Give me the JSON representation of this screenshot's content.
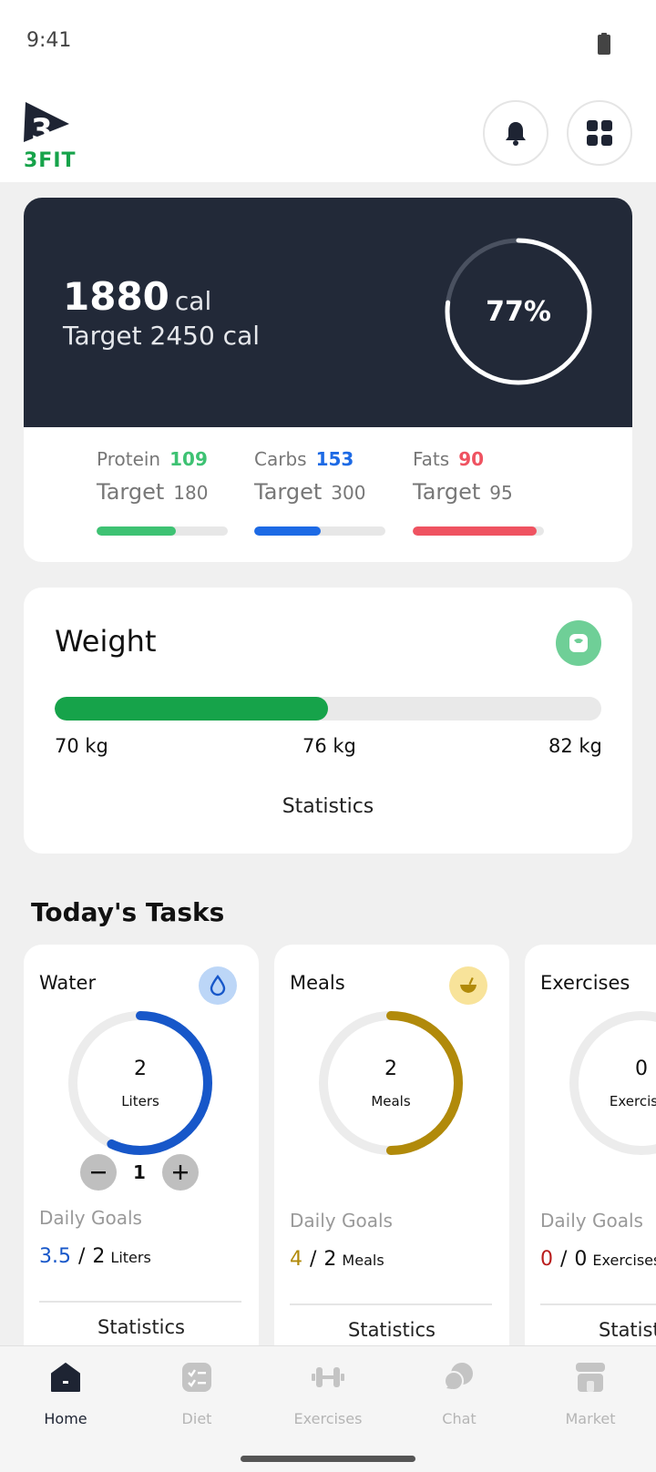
{
  "status": {
    "time": "9:41"
  },
  "app": {
    "logo_text": "3FIT"
  },
  "calories": {
    "current": "1880",
    "unit": "cal",
    "target_text": "Target 2450 cal",
    "percent_text": "77%",
    "percent_value": 77
  },
  "macros": [
    {
      "name": "Protein",
      "value": "109",
      "target_label": "Target",
      "target": "180",
      "color": "#3ec273",
      "fill": 0.605
    },
    {
      "name": "Carbs",
      "value": "153",
      "target_label": "Target",
      "target": "300",
      "color": "#1d6ae5",
      "fill": 0.51
    },
    {
      "name": "Fats",
      "value": "90",
      "target_label": "Target",
      "target": "95",
      "color": "#ef5361",
      "fill": 0.947
    }
  ],
  "weight": {
    "title": "Weight",
    "start": "70 kg",
    "current": "76 kg",
    "goal": "82 kg",
    "progress": 0.5,
    "stats_label": "Statistics"
  },
  "tasks": {
    "title": "Today's Tasks",
    "cards": [
      {
        "title": "Water",
        "value": "2",
        "unit": "Liters",
        "progress": 0.57,
        "ring_color": "#1757c9",
        "icon_bg": "#bcd6f7",
        "stepper_value": "1",
        "daily_label": "Daily Goals",
        "goal_current": "3.5",
        "goal_current_color": "#1757c9",
        "goal_target": "2",
        "goal_unit": "Liters",
        "stats_label": "Statistics"
      },
      {
        "title": "Meals",
        "value": "2",
        "unit": "Meals",
        "progress": 0.5,
        "ring_color": "#b18a0a",
        "icon_bg": "#f8e39a",
        "daily_label": "Daily Goals",
        "goal_current": "4",
        "goal_current_color": "#b18a0a",
        "goal_target": "2",
        "goal_unit": "Meals",
        "stats_label": "Statistics"
      },
      {
        "title": "Exercises",
        "value": "0",
        "unit": "Exercises",
        "progress": 0,
        "ring_color": "#b91c1c",
        "daily_label": "Daily Goals",
        "goal_current": "0",
        "goal_current_color": "#b91c1c",
        "goal_target": "0",
        "goal_unit": "Exercises",
        "stats_label": "Statistics"
      }
    ]
  },
  "nav": [
    {
      "label": "Home",
      "icon": "home-icon",
      "active": true
    },
    {
      "label": "Diet",
      "icon": "diet-icon"
    },
    {
      "label": "Exercises",
      "icon": "dumbbell-icon"
    },
    {
      "label": "Chat",
      "icon": "chat-icon"
    },
    {
      "label": "Market",
      "icon": "store-icon"
    }
  ],
  "colors": {
    "dark_card": "#222938",
    "brand_green": "#16a34a"
  }
}
